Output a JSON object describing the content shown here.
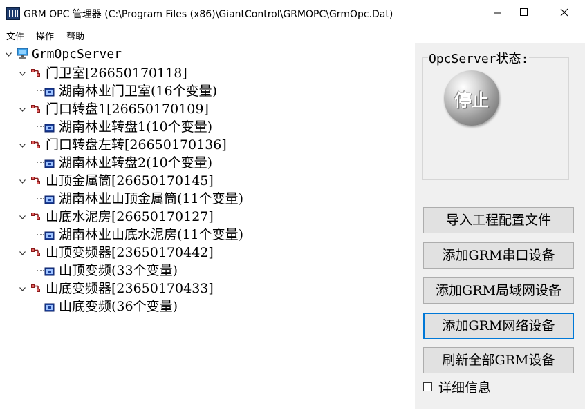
{
  "window": {
    "title": "GRM OPC 管理器  (C:\\Program Files (x86)\\GiantControl\\GRMOPC\\GrmOpc.Dat)"
  },
  "menu": [
    "文件",
    "操作",
    "帮助"
  ],
  "tree": {
    "root": "GrmOpcServer",
    "devices": [
      {
        "label": "门卫室[26650170118]",
        "child": "湖南林业门卫室(16个变量)"
      },
      {
        "label": "门口转盘1[26650170109]",
        "child": "湖南林业转盘1(10个变量)"
      },
      {
        "label": "门口转盘左转[26650170136]",
        "child": "湖南林业转盘2(10个变量)"
      },
      {
        "label": "山顶金属筒[26650170145]",
        "child": "湖南林业山顶金属筒(11个变量)"
      },
      {
        "label": "山底水泥房[26650170127]",
        "child": "湖南林业山底水泥房(11个变量)"
      },
      {
        "label": "山顶变频器[23650170442]",
        "child": "山顶变频(33个变量)"
      },
      {
        "label": "山底变频器[23650170433]",
        "child": "山底变频(36个变量)"
      }
    ]
  },
  "status": {
    "title": "OpcServer状态:",
    "state": "停止"
  },
  "buttons": [
    "导入工程配置文件",
    "添加GRM串口设备",
    "添加GRM局域网设备",
    "添加GRM网络设备",
    "刷新全部GRM设备"
  ],
  "details_checkbox": {
    "label": "详细信息",
    "checked": false
  }
}
